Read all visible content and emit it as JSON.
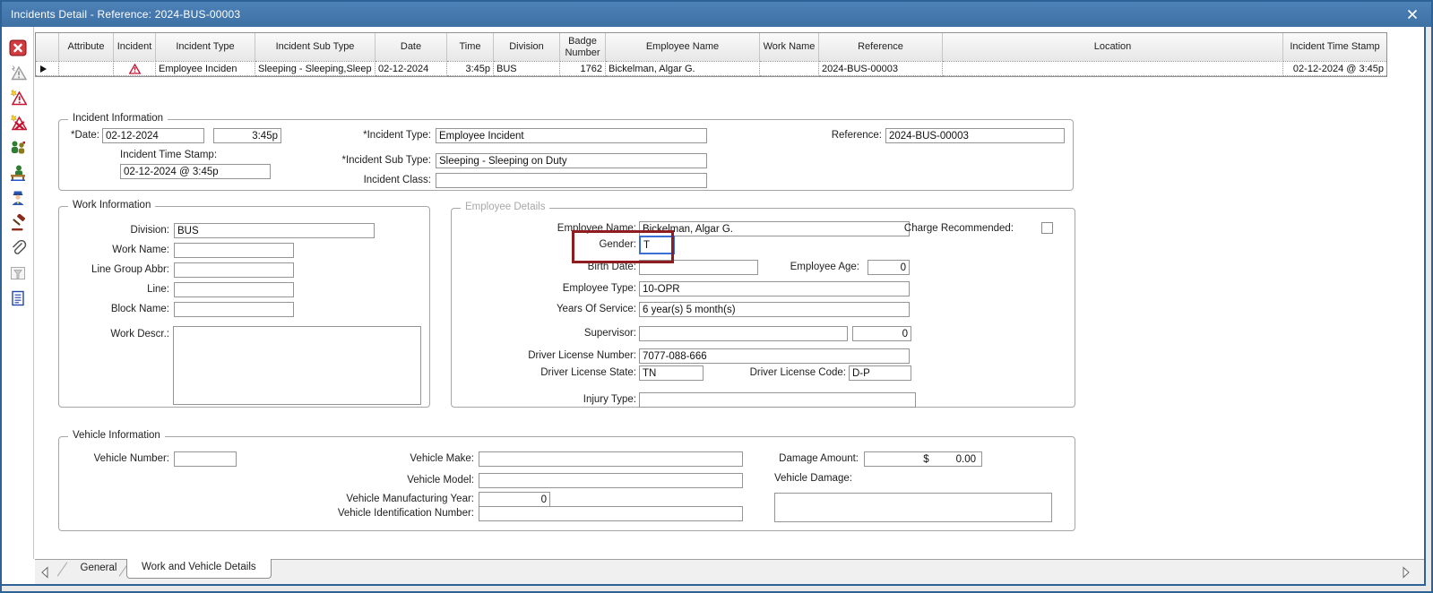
{
  "titlebar": {
    "title": "Incidents Detail - Reference: 2024-BUS-00003"
  },
  "icons": {
    "titlebar_close": "x-mark",
    "row_selector": "black-right-triangle",
    "incident_warning": "red-warning-triangle",
    "tab_scroll_left": "hollow-left-triangle",
    "tab_scroll_right": "hollow-right-triangle",
    "toolbar": [
      "red-x-delete",
      "warning-triangle-disabled",
      "warning-triangle-new",
      "warning-triangle-remove",
      "people",
      "employee-at-desk",
      "police-officer",
      "gavel",
      "paperclip",
      "filter-disabled",
      "document-notes"
    ]
  },
  "grid": {
    "columns": [
      "",
      "Attribute",
      "Incident",
      "Incident Type",
      "Incident Sub Type",
      "Date",
      "Time",
      "Division",
      "Badge Number",
      "Employee Name",
      "Work Name",
      "Reference",
      "Location",
      "Incident Time Stamp"
    ],
    "row": {
      "attribute": "",
      "incident_type": "Employee Inciden",
      "incident_sub_type": "Sleeping - Sleeping,Sleep",
      "date": "02-12-2024",
      "time": "3:45p",
      "division": "BUS",
      "badge_number": "1762",
      "employee_name": "Bickelman, Algar G.",
      "work_name": "",
      "reference": "2024-BUS-00003",
      "location": "",
      "incident_time_stamp": "02-12-2024 @  3:45p"
    }
  },
  "incident_information": {
    "legend": "Incident Information",
    "date_label": "*Date:",
    "date_value": "02-12-2024",
    "time_value": "3:45p",
    "timestamp_label": "Incident Time Stamp:",
    "timestamp_value": "02-12-2024 @  3:45p",
    "incident_type_label": "*Incident Type:",
    "incident_type_value": "Employee Incident",
    "incident_sub_type_label": "*Incident Sub Type:",
    "incident_sub_type_value": "Sleeping - Sleeping on Duty",
    "incident_class_label": "Incident Class:",
    "incident_class_value": "",
    "reference_label": "Reference:",
    "reference_value": "2024-BUS-00003"
  },
  "work_information": {
    "legend": "Work Information",
    "division_label": "Division:",
    "division_value": "BUS",
    "work_name_label": "Work Name:",
    "work_name_value": "",
    "line_group_label": "Line Group Abbr:",
    "line_group_value": "",
    "line_label": "Line:",
    "line_value": "",
    "block_name_label": "Block Name:",
    "block_name_value": "",
    "work_descr_label": "Work Descr.:",
    "work_descr_value": ""
  },
  "employee_details": {
    "legend": "Employee Details",
    "employee_name_label": "Employee Name:",
    "employee_name_value": "Bickelman, Algar G.",
    "charge_label": "Charge Recommended:",
    "charge_checked": false,
    "gender_label": "Gender:",
    "gender_value": "T",
    "birth_date_label": "Birth Date:",
    "birth_date_value": "",
    "employee_age_label": "Employee Age:",
    "employee_age_value": "0",
    "employee_type_label": "Employee Type:",
    "employee_type_value": "10-OPR",
    "years_label": "Years Of Service:",
    "years_value": "6 year(s) 5 month(s)",
    "supervisor_label": "Supervisor:",
    "supervisor_value": "",
    "supervisor_count": "0",
    "dln_label": "Driver License Number:",
    "dln_value": "7077-088-666",
    "dls_label": "Driver License State:",
    "dls_value": "TN",
    "dlc_label": "Driver License Code:",
    "dlc_value": "D-P",
    "injury_label": "Injury Type:",
    "injury_value": ""
  },
  "vehicle_information": {
    "legend": "Vehicle Information",
    "vehicle_number_label": "Vehicle Number:",
    "vehicle_number_value": "",
    "vehicle_make_label": "Vehicle Make:",
    "vehicle_make_value": "",
    "vehicle_model_label": "Vehicle Model:",
    "vehicle_model_value": "",
    "vehicle_year_label": "Vehicle Manufacturing Year:",
    "vehicle_year_value": "0",
    "vin_label": "Vehicle Identification Number:",
    "vin_value": "",
    "damage_amount_label": "Damage Amount:",
    "damage_currency": "$",
    "damage_amount_value": "0.00",
    "vehicle_damage_label": "Vehicle Damage:",
    "vehicle_damage_value": ""
  },
  "tabs": {
    "items": [
      {
        "label": "General",
        "active": false
      },
      {
        "label": "Work and Vehicle Details",
        "active": true
      }
    ]
  },
  "colors": {
    "titlebar_blue": "#3f74a8",
    "window_border": "#2e6195",
    "highlight_box": "#8f1d1f",
    "focus_border": "#3a6fd8",
    "warning_red": "#c41230"
  }
}
